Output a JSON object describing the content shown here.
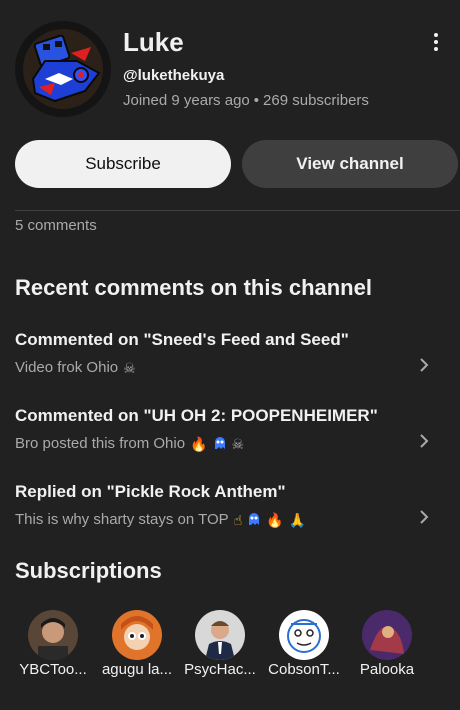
{
  "channel": {
    "name": "Luke",
    "handle": "@lukethekuya",
    "joined": "Joined 9 years ago",
    "subscribers": "269 subscribers"
  },
  "buttons": {
    "subscribe": "Subscribe",
    "view_channel": "View channel"
  },
  "comments_count": "5 comments",
  "recent_section": {
    "title": "Recent comments on this channel",
    "items": [
      {
        "title": "Commented on \"Sneed's Feed and Seed\"",
        "text": "Video frok Ohio",
        "emojis": [
          "skull-crossbones-icon"
        ]
      },
      {
        "title": "Commented on \"UH OH 2: POOPENHEIMER\"",
        "text": "Bro posted this from Ohio",
        "emojis": [
          "fire-icon",
          "ghost-icon",
          "skull-crossbones-icon"
        ]
      },
      {
        "title": "Replied on \"Pickle Rock Anthem\"",
        "text": "This is why sharty stays on TOP",
        "emojis": [
          "point-up-icon",
          "ghost-icon",
          "fire-icon",
          "praying-hands-icon"
        ]
      }
    ]
  },
  "subscriptions": {
    "title": "Subscriptions",
    "items": [
      {
        "label": "YBCToo...",
        "color": "#6b4f3a"
      },
      {
        "label": "agugu la...",
        "color": "#e0742a"
      },
      {
        "label": "PsycHac...",
        "color": "#cfcfcf"
      },
      {
        "label": "CobsonT...",
        "color": "#ffffff"
      },
      {
        "label": "Palooka",
        "color": "#7a2a3a"
      }
    ]
  },
  "colors": {
    "background": "#212121",
    "primary_text": "#f1f1f1",
    "secondary_text": "#aaaaaa",
    "subscribe_bg": "#f1f1f1",
    "view_channel_bg": "#3f3f3f"
  }
}
